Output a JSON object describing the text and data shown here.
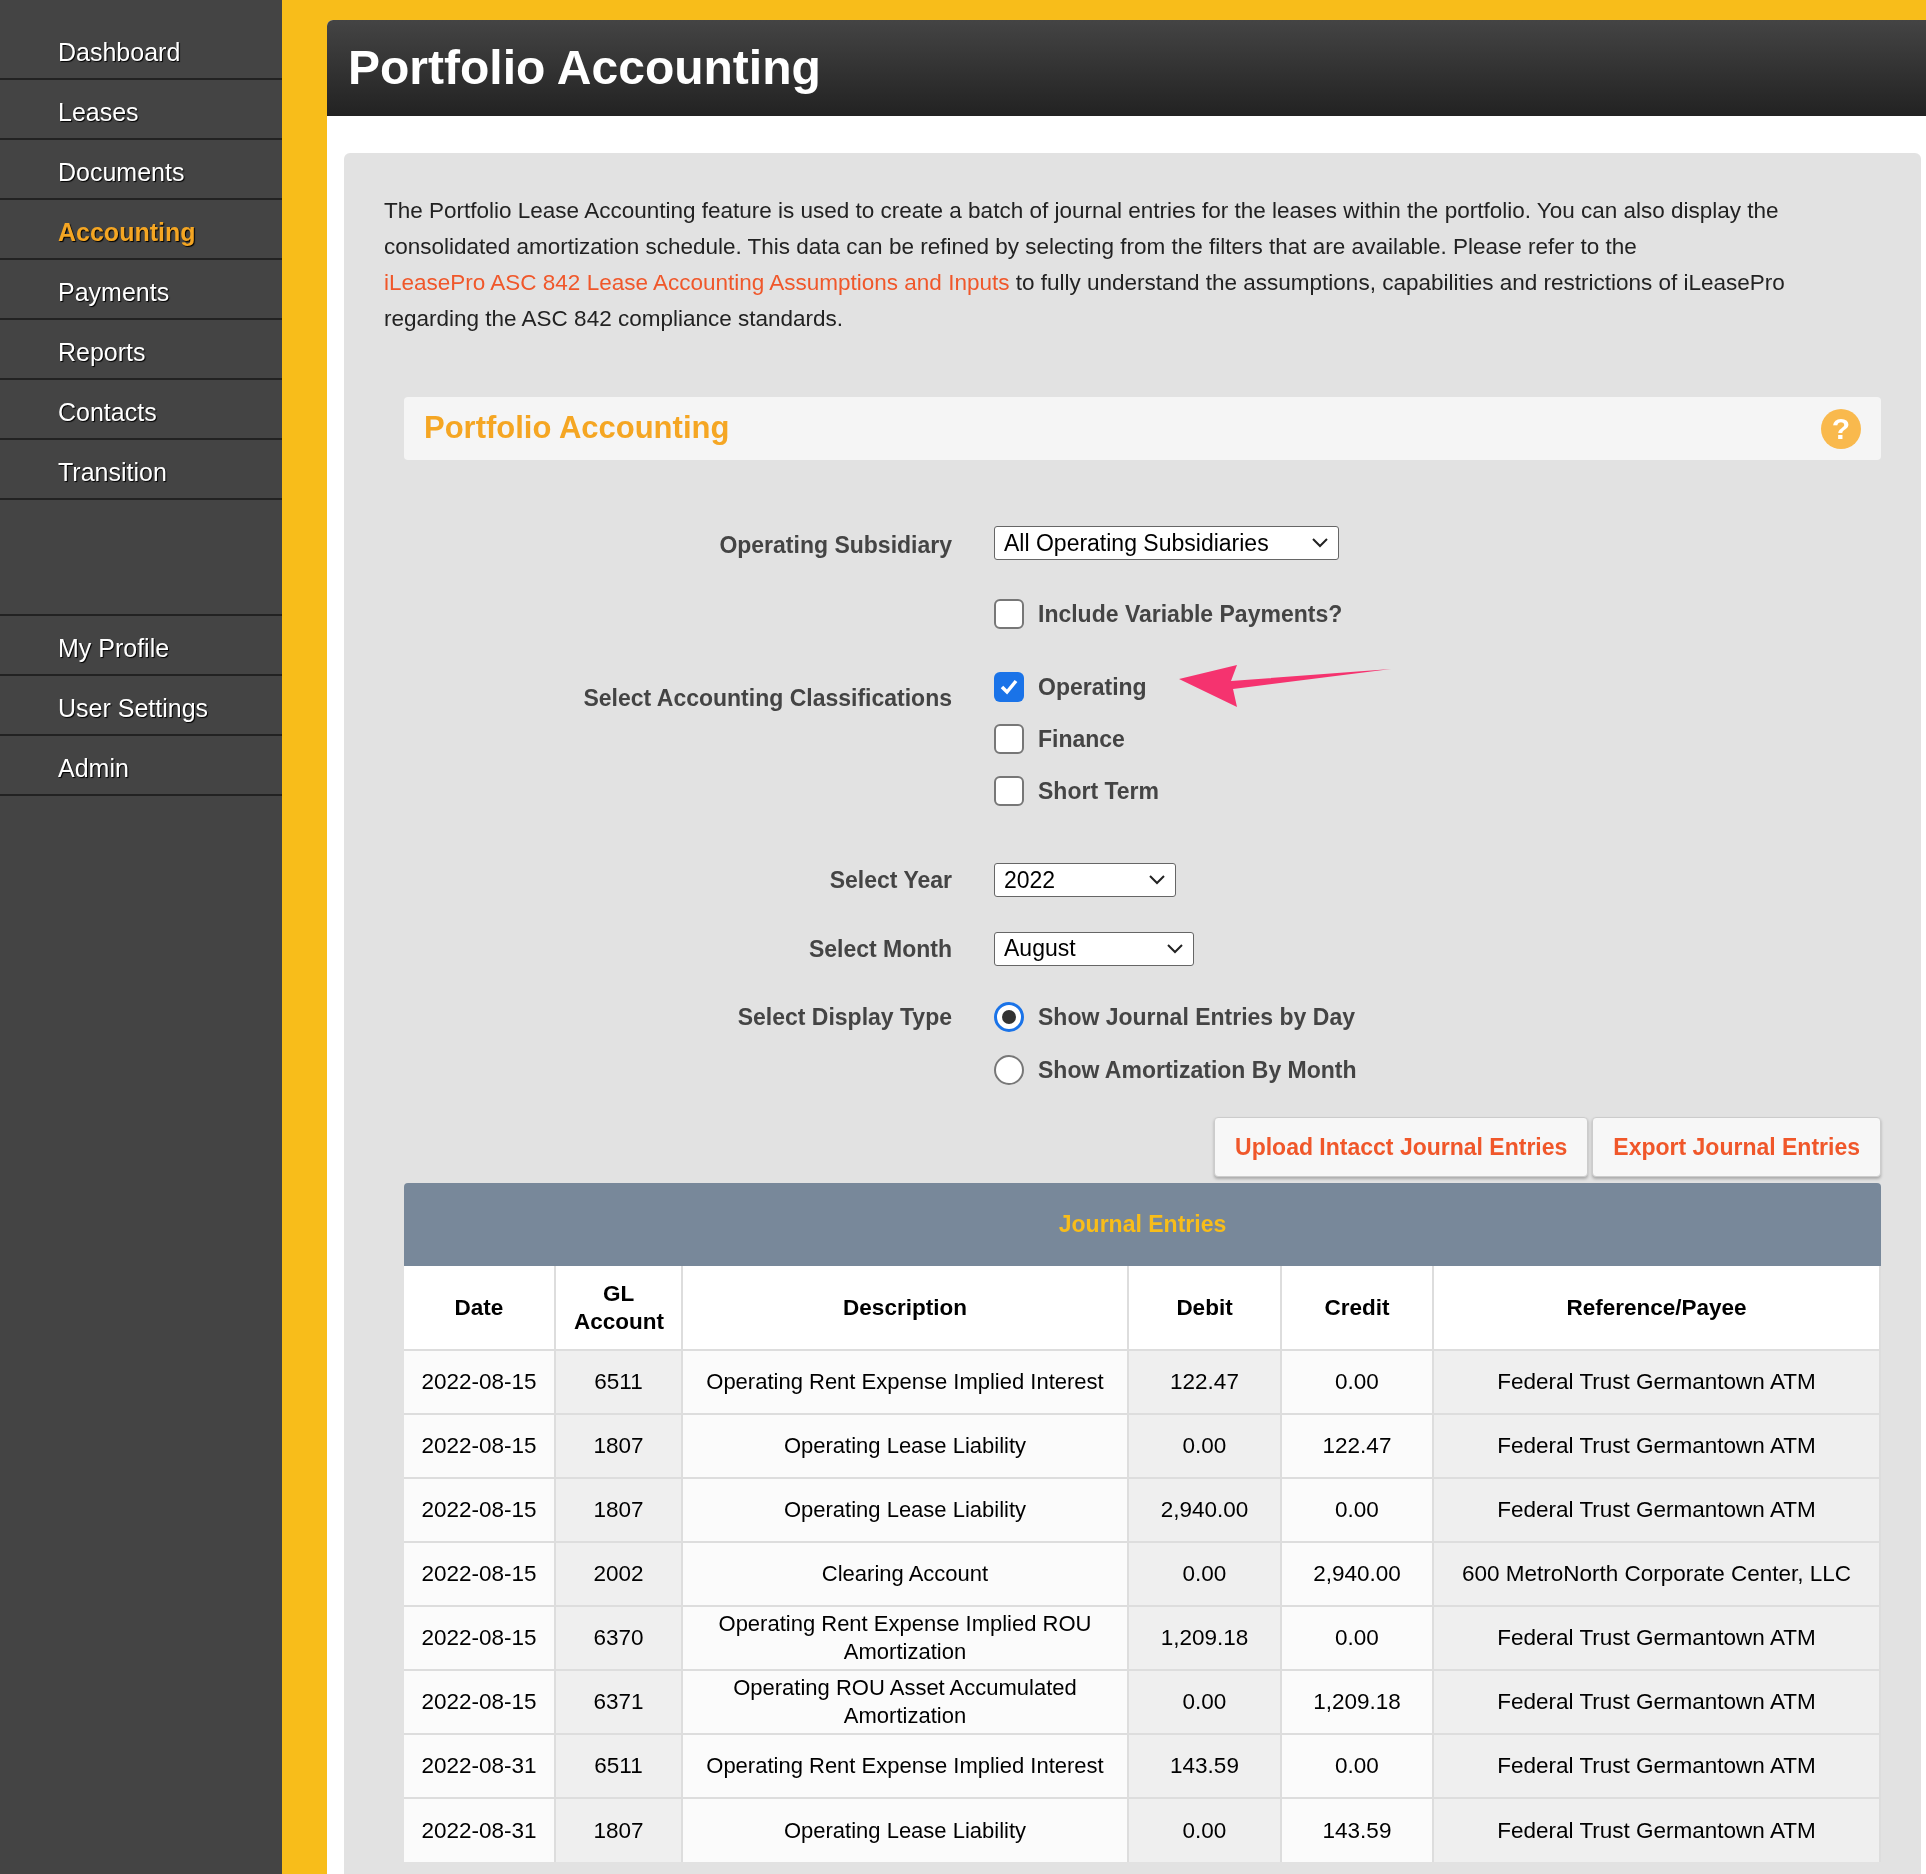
{
  "sidebar": {
    "items": [
      {
        "label": "Dashboard",
        "selected": false
      },
      {
        "label": "Leases",
        "selected": false
      },
      {
        "label": "Documents",
        "selected": false
      },
      {
        "label": "Accounting",
        "selected": true
      },
      {
        "label": "Payments",
        "selected": false
      },
      {
        "label": "Reports",
        "selected": false
      },
      {
        "label": "Contacts",
        "selected": false
      },
      {
        "label": "Transition",
        "selected": false
      }
    ],
    "bottom_items": [
      {
        "label": "My Profile",
        "selected": false
      },
      {
        "label": "User Settings",
        "selected": false
      },
      {
        "label": "Admin",
        "selected": false
      }
    ]
  },
  "page_title": "Portfolio Accounting",
  "intro": {
    "before": "The Portfolio Lease Accounting feature is used to create a batch of journal entries for the leases within the portfolio. You can also display the consolidated amortization schedule. This data can be refined by selecting from the filters that are available. Please refer to the ",
    "link": "iLeasePro ASC 842 Lease Accounting Assumptions and Inputs",
    "after": " to fully understand the assumptions, capabilities and restrictions of iLeasePro regarding the ASC 842 compliance standards."
  },
  "section": {
    "title": "Portfolio Accounting",
    "help": "?"
  },
  "form": {
    "subsidiary": {
      "label": "Operating Subsidiary",
      "value": "All Operating Subsidiaries"
    },
    "variable_payments": {
      "label": "Include Variable Payments?",
      "checked": false
    },
    "classifications": {
      "label": "Select Accounting Classifications",
      "options": [
        {
          "label": "Operating",
          "checked": true
        },
        {
          "label": "Finance",
          "checked": false
        },
        {
          "label": "Short Term",
          "checked": false
        }
      ]
    },
    "year": {
      "label": "Select Year",
      "value": "2022"
    },
    "month": {
      "label": "Select Month",
      "value": "August"
    },
    "display_type": {
      "label": "Select Display Type",
      "options": [
        {
          "label": "Show Journal Entries by Day",
          "selected": true
        },
        {
          "label": "Show Amortization By Month",
          "selected": false
        }
      ]
    }
  },
  "buttons": [
    "Upload Intacct Journal Entries",
    "Export Journal Entries"
  ],
  "table": {
    "title": "Journal Entries",
    "columns": [
      "Date",
      "GL Account",
      "Description",
      "Debit",
      "Credit",
      "Reference/Payee"
    ],
    "rows": [
      [
        "2022-08-15",
        "6511",
        "Operating Rent Expense Implied Interest",
        "122.47",
        "0.00",
        "Federal Trust Germantown ATM"
      ],
      [
        "2022-08-15",
        "1807",
        "Operating Lease Liability",
        "0.00",
        "122.47",
        "Federal Trust Germantown ATM"
      ],
      [
        "2022-08-15",
        "1807",
        "Operating Lease Liability",
        "2,940.00",
        "0.00",
        "Federal Trust Germantown ATM"
      ],
      [
        "2022-08-15",
        "2002",
        "Clearing Account",
        "0.00",
        "2,940.00",
        "600 MetroNorth Corporate Center, LLC"
      ],
      [
        "2022-08-15",
        "6370",
        "Operating Rent Expense Implied ROU Amortization",
        "1,209.18",
        "0.00",
        "Federal Trust Germantown ATM"
      ],
      [
        "2022-08-15",
        "6371",
        "Operating ROU Asset Accumulated Amortization",
        "0.00",
        "1,209.18",
        "Federal Trust Germantown ATM"
      ],
      [
        "2022-08-31",
        "6511",
        "Operating Rent Expense Implied Interest",
        "143.59",
        "0.00",
        "Federal Trust Germantown ATM"
      ],
      [
        "2022-08-31",
        "1807",
        "Operating Lease Liability",
        "0.00",
        "143.59",
        "Federal Trust Germantown ATM"
      ]
    ]
  }
}
